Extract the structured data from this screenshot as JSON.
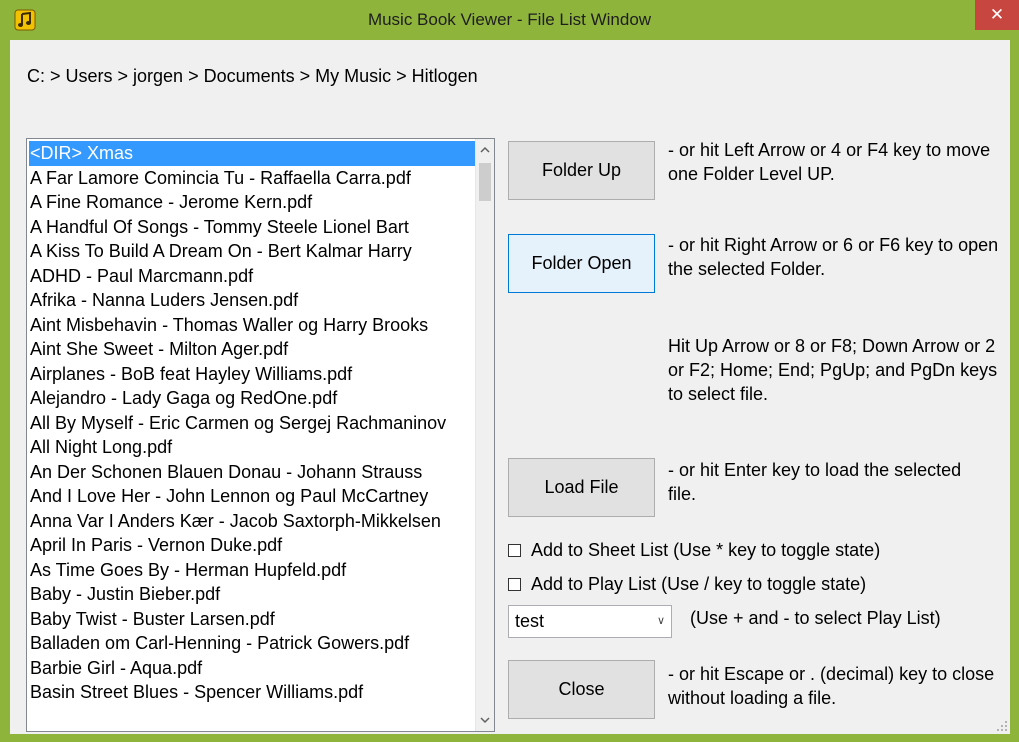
{
  "window": {
    "title": "Music Book Viewer - File List Window",
    "close_label": "✕",
    "accent": "#8fb43c",
    "close_color": "#c7463f"
  },
  "breadcrumb": "C: > Users > jorgen > Documents > My Music > Hitlogen",
  "file_list": {
    "items": [
      "<DIR> Xmas",
      "A Far Lamore Comincia Tu - Raffaella Carra.pdf",
      "A Fine Romance - Jerome Kern.pdf",
      "A Handful Of Songs - Tommy Steele Lionel Bart",
      "A Kiss To Build A Dream On -  Bert Kalmar Harry",
      "ADHD - Paul Marcmann.pdf",
      "Afrika - Nanna Luders Jensen.pdf",
      "Aint Misbehavin - Thomas Waller og Harry Brooks",
      "Aint She Sweet - Milton Ager.pdf",
      "Airplanes - BoB feat Hayley Williams.pdf",
      "Alejandro - Lady Gaga og RedOne.pdf",
      "All By Myself - Eric Carmen og Sergej Rachmaninov",
      "All Night Long.pdf",
      "An Der Schonen Blauen Donau - Johann Strauss",
      "And I Love Her - John Lennon og Paul McCartney",
      "Anna Var I Anders Kær - Jacob Saxtorph-Mikkelsen",
      "April In Paris - Vernon Duke.pdf",
      "As Time Goes By - Herman Hupfeld.pdf",
      "Baby - Justin Bieber.pdf",
      "Baby Twist - Buster Larsen.pdf",
      "Balladen om Carl-Henning - Patrick Gowers.pdf",
      "Barbie Girl - Aqua.pdf",
      "Basin Street Blues - Spencer Williams.pdf"
    ],
    "selected_index": 0
  },
  "buttons": {
    "folder_up": "Folder Up",
    "folder_open": "Folder Open",
    "load_file": "Load File",
    "close": "Close"
  },
  "hints": {
    "folder_up": "- or hit Left Arrow or 4 or F4 key to move one Folder Level UP.",
    "folder_open": "- or hit Right Arrow or 6 or F6 key to open the selected Folder.",
    "navigation": "Hit Up Arrow or 8 or F8; Down Arrow or 2 or F2; Home; End; PgUp; and PgDn keys to select file.",
    "load_file": "- or hit Enter key to load the selected file.",
    "play_list_select": "(Use + and - to select Play List)",
    "close": "- or hit Escape or . (decimal) key to close without loading a file."
  },
  "checkboxes": {
    "sheet_list": {
      "label": "Add to Sheet List (Use * key to toggle state)",
      "checked": false
    },
    "play_list": {
      "label": "Add to Play List (Use / key to toggle state)",
      "checked": false
    }
  },
  "play_list_select": {
    "value": "test"
  },
  "icons": {
    "app": "music-note-icon",
    "close": "close-icon",
    "dropdown": "chevron-down-icon",
    "scroll_up": "scroll-up-arrow-icon",
    "scroll_down": "scroll-down-arrow-icon"
  }
}
